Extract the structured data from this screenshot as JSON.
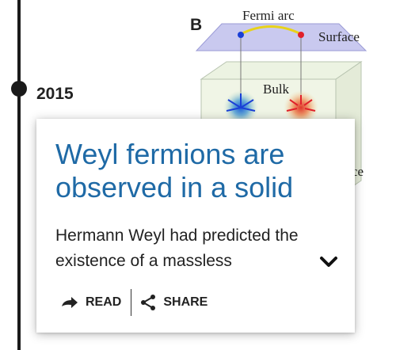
{
  "timeline": {
    "year": "2015"
  },
  "figure": {
    "panel_label": "B",
    "arc_label": "Fermi  arc",
    "surface_label": "Surface",
    "bulk_label": "Bulk",
    "partial_label": "ce"
  },
  "card": {
    "title": "Weyl fermions are observed in a solid",
    "excerpt": "Hermann Weyl had predicted the existence of a massless",
    "actions": {
      "read_label": "READ",
      "share_label": "SHARE"
    }
  },
  "colors": {
    "title": "#1f6aa6",
    "timeline": "#1a1a1a",
    "text": "#222222"
  },
  "icons": {
    "expand": "chevron-down-icon",
    "read": "arrow-right-icon",
    "share": "share-icon"
  }
}
